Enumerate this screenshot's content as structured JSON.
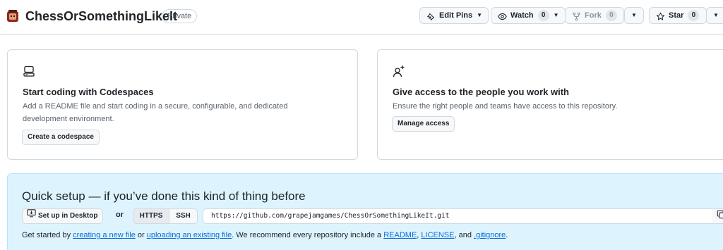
{
  "header": {
    "repo_name": "ChessOrSomethingLikeIt",
    "visibility": "Private",
    "edit_pins": "Edit Pins",
    "watch": {
      "label": "Watch",
      "count": "0"
    },
    "fork": {
      "label": "Fork",
      "count": "0"
    },
    "star": {
      "label": "Star",
      "count": "0"
    }
  },
  "codespaces_card": {
    "title": "Start coding with Codespaces",
    "description": "Add a README file and start coding in a secure, configurable, and dedicated development environment.",
    "button": "Create a codespace"
  },
  "access_card": {
    "title": "Give access to the people you work with",
    "description": "Ensure the right people and teams have access to this repository.",
    "button": "Manage access"
  },
  "quick_setup": {
    "title": "Quick setup — if you’ve done this kind of thing before",
    "desktop_button": "Set up in Desktop",
    "or": "or",
    "https": "HTTPS",
    "ssh": "SSH",
    "url": "https://github.com/grapejamgames/ChessOrSomethingLikeIt.git",
    "text_1": "Get started by ",
    "link_new_file": "creating a new file",
    "text_2": " or ",
    "link_upload": "uploading an existing file",
    "text_3": ". We recommend every repository include a ",
    "link_readme": "README",
    "text_4": ", ",
    "link_license": "LICENSE",
    "text_5": ", and ",
    "link_gitignore": ".gitignore",
    "text_6": "."
  },
  "icons": {
    "avatar": "repo-avatar-icon",
    "edit_pins": "pin-icon",
    "watch": "eye-icon",
    "fork": "repo-forked-icon",
    "star": "star-icon",
    "codespaces": "codespaces-icon",
    "access": "person-add-icon",
    "desktop": "desktop-download-icon",
    "copy": "copy-icon"
  }
}
